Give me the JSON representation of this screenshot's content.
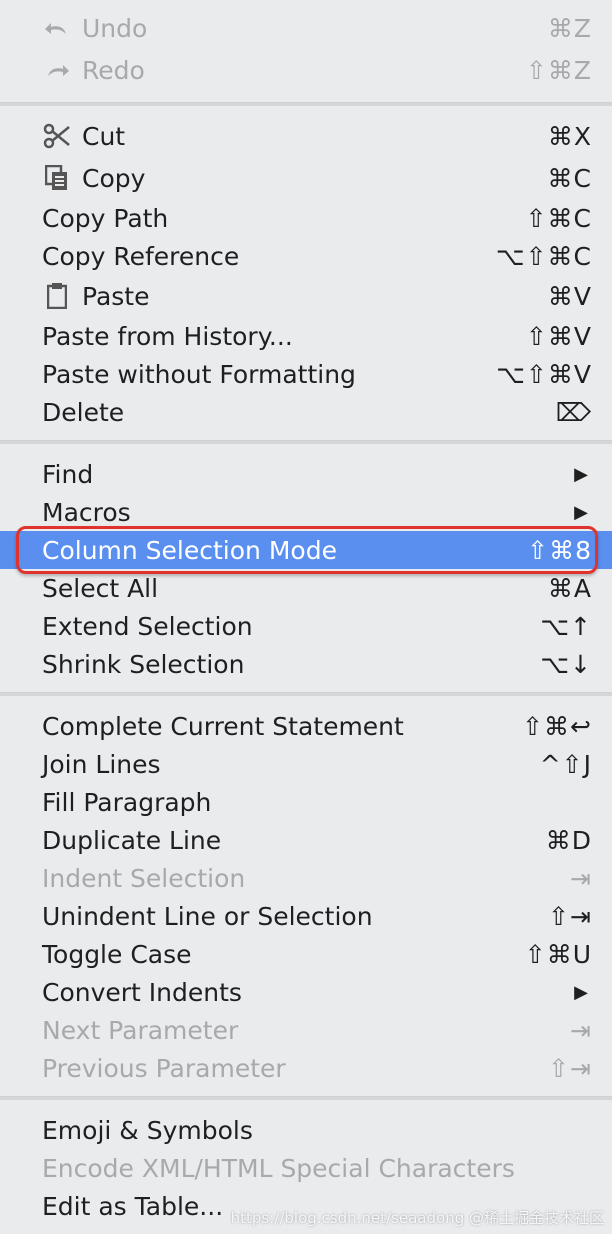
{
  "menu": {
    "undo": {
      "label": "Undo",
      "shortcut": "⌘Z",
      "icon": "undo-icon"
    },
    "redo": {
      "label": "Redo",
      "shortcut": "⇧⌘Z",
      "icon": "redo-icon"
    },
    "cut": {
      "label": "Cut",
      "shortcut": "⌘X",
      "icon": "scissors-icon"
    },
    "copy": {
      "label": "Copy",
      "shortcut": "⌘C",
      "icon": "copy-icon"
    },
    "copy_path": {
      "label": "Copy Path",
      "shortcut": "⇧⌘C"
    },
    "copy_reference": {
      "label": "Copy Reference",
      "shortcut": "⌥⇧⌘C"
    },
    "paste": {
      "label": "Paste",
      "shortcut": "⌘V",
      "icon": "clipboard-icon"
    },
    "paste_history": {
      "label": "Paste from History...",
      "shortcut": "⇧⌘V"
    },
    "paste_no_format": {
      "label": "Paste without Formatting",
      "shortcut": "⌥⇧⌘V"
    },
    "delete": {
      "label": "Delete",
      "shortcut": "⌦"
    },
    "find": {
      "label": "Find"
    },
    "macros": {
      "label": "Macros"
    },
    "column_selection": {
      "label": "Column Selection Mode",
      "shortcut": "⇧⌘8"
    },
    "select_all": {
      "label": "Select All",
      "shortcut": "⌘A"
    },
    "extend_selection": {
      "label": "Extend Selection",
      "shortcut": "⌥↑"
    },
    "shrink_selection": {
      "label": "Shrink Selection",
      "shortcut": "⌥↓"
    },
    "complete_statement": {
      "label": "Complete Current Statement",
      "shortcut": "⇧⌘↩"
    },
    "join_lines": {
      "label": "Join Lines",
      "shortcut": "^⇧J"
    },
    "fill_paragraph": {
      "label": "Fill Paragraph"
    },
    "duplicate_line": {
      "label": "Duplicate Line",
      "shortcut": "⌘D"
    },
    "indent_selection": {
      "label": "Indent Selection",
      "shortcut": "⇥"
    },
    "unindent": {
      "label": "Unindent Line or Selection",
      "shortcut": "⇧⇥"
    },
    "toggle_case": {
      "label": "Toggle Case",
      "shortcut": "⇧⌘U"
    },
    "convert_indents": {
      "label": "Convert Indents"
    },
    "next_parameter": {
      "label": "Next Parameter",
      "shortcut": "⇥"
    },
    "previous_parameter": {
      "label": "Previous Parameter",
      "shortcut": "⇧⇥"
    },
    "emoji_symbols": {
      "label": "Emoji & Symbols"
    },
    "encode_xml": {
      "label": "Encode XML/HTML Special Characters"
    },
    "edit_as_table": {
      "label": "Edit as Table..."
    },
    "submenu_arrow": "▶"
  },
  "watermark": "https://blog.csdn.net/seaadong @稀土掘金技术社区",
  "colors": {
    "background": "#e9ebed",
    "selection": "#5a8ff0",
    "highlight_box": "#e0332d",
    "disabled_text": "#a7a9ac"
  }
}
